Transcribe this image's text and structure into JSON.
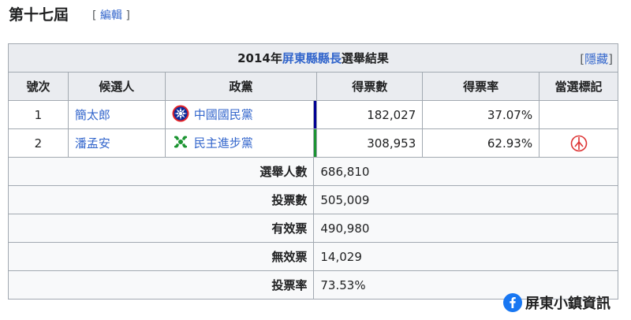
{
  "section": {
    "heading": "第十七屆",
    "edit_open": "[",
    "edit_label": "編輯",
    "edit_close": "]"
  },
  "table": {
    "caption_year": "2014年",
    "caption_link": "屏東縣縣長",
    "caption_suffix": "選舉結果",
    "hide_open": "[",
    "hide_label": "隱藏",
    "hide_close": "]",
    "headers": [
      "號次",
      "候選人",
      "政黨",
      "得票數",
      "得票率",
      "當選標記"
    ],
    "candidates": [
      {
        "num": "1",
        "name": "簡太郎",
        "party": "中國國民黨",
        "party_icon": "kmt-sun-icon",
        "party_color": "#000095",
        "votes": "182,027",
        "pct": "37.07%",
        "elected": false
      },
      {
        "num": "2",
        "name": "潘孟安",
        "party": "民主進步黨",
        "party_icon": "dpp-flag-icon",
        "party_color": "#1B9431",
        "votes": "308,953",
        "pct": "62.93%",
        "elected": true
      }
    ],
    "summary": [
      {
        "label": "選舉人數",
        "value": "686,810"
      },
      {
        "label": "投票數",
        "value": "505,009"
      },
      {
        "label": "有效票",
        "value": "490,980"
      },
      {
        "label": "無效票",
        "value": "14,029"
      },
      {
        "label": "投票率",
        "value": "73.53%"
      }
    ]
  },
  "watermark": {
    "text": "屏東小鎮資訊",
    "icon": "facebook-icon",
    "color": "#1877f2"
  },
  "colors": {
    "elected_mark": "#dd3333",
    "link": "#3366cc"
  }
}
